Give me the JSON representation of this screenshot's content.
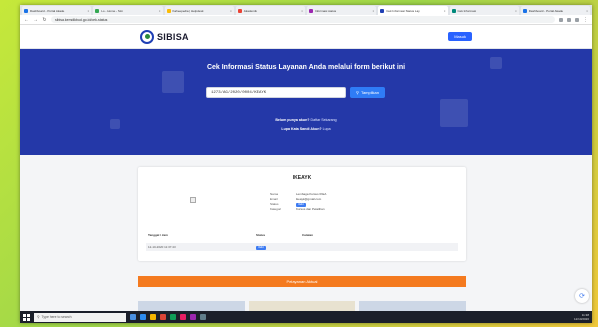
{
  "browser": {
    "tabs": [
      {
        "label": "Dashboard - Portal Akade",
        "color": "#1a73e8"
      },
      {
        "label": "Lo - Home - Sim",
        "color": "#34a853"
      },
      {
        "label": "Kaheepedia | Helpdesk",
        "color": "#fbbc05"
      },
      {
        "label": "Akademik",
        "color": "#ea4335"
      },
      {
        "label": "Informasi status",
        "color": "#9c27b0"
      },
      {
        "label": "Cek Informasi Status Lay",
        "color": "#1f3fb4",
        "active": true
      },
      {
        "label": "Cek Informasi",
        "color": "#00897b"
      },
      {
        "label": "Dashboard - Portal Akade",
        "color": "#1a73e8"
      }
    ],
    "url": "sibisa.kemdikbud.go.id/cek-status"
  },
  "header": {
    "logo_text": "SIBISA",
    "login_label": "Masuk"
  },
  "hero": {
    "title": "Cek Informasi Status Layanan Anda melalui form berikut ini",
    "search_value": "1273/AG/2020/0004/KEAYK",
    "search_button": "Tampilkan",
    "register_prompt": "Belum punya akun?",
    "register_link": "Daftar Sekarang",
    "forgot_prompt": "Lupa Kata Sandi Akun?",
    "forgot_link": "Lupa"
  },
  "result": {
    "title": "IKEAYK",
    "fields": [
      {
        "key": "Nama",
        "value": "Lembaga Kursus IKEA"
      },
      {
        "key": "Email",
        "value": "ikeayk@gmail.com"
      },
      {
        "key": "Status",
        "value": "Valid",
        "badge": true
      },
      {
        "key": "Kategori",
        "value": "Kursus dan Pelatihan"
      }
    ],
    "table_headers": [
      "Tanggal / Jam",
      "Status",
      "Catatan"
    ],
    "rows": [
      {
        "date": "12-10-2020 11:37:43",
        "status": "Valid",
        "note": ""
      }
    ]
  },
  "cta": {
    "label": "Pelayanan Aktual"
  },
  "taskbar": {
    "search_placeholder": "Type here to search",
    "time": "11:38",
    "date": "12/10/2020"
  }
}
